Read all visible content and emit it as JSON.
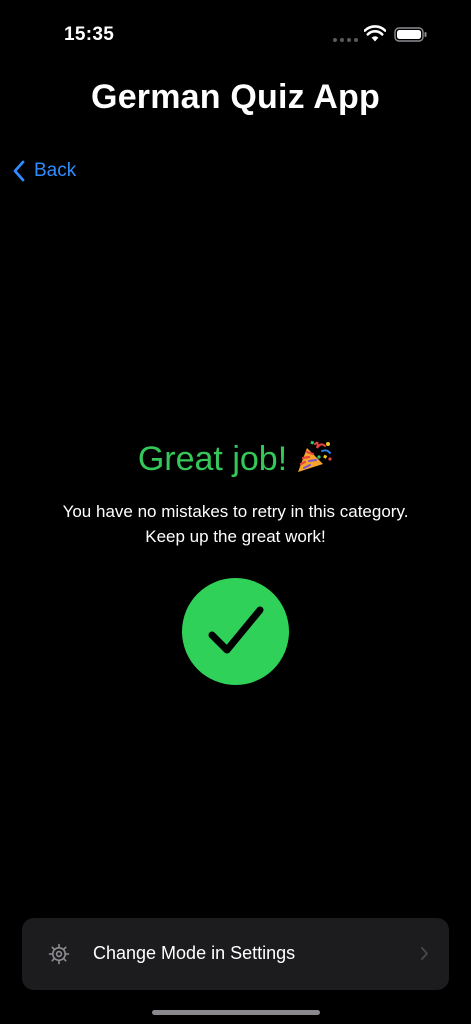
{
  "status_bar": {
    "time": "15:35"
  },
  "header": {
    "title": "German Quiz App",
    "back_label": "Back"
  },
  "result": {
    "title": "Great job!",
    "message_line1": "You have no mistakes to retry in this category.",
    "message_line2": "Keep up the great work!"
  },
  "settings_row": {
    "label": "Change Mode in Settings"
  },
  "colors": {
    "accent_blue": "#2f8cff",
    "success_green": "#34c759",
    "badge_green": "#30d158",
    "row_background": "#1c1c1e"
  },
  "icons": {
    "back": "chevron-left-icon",
    "celebration": "party-popper-icon",
    "success": "checkmark-icon",
    "settings": "gear-icon",
    "disclosure": "chevron-right-icon"
  }
}
